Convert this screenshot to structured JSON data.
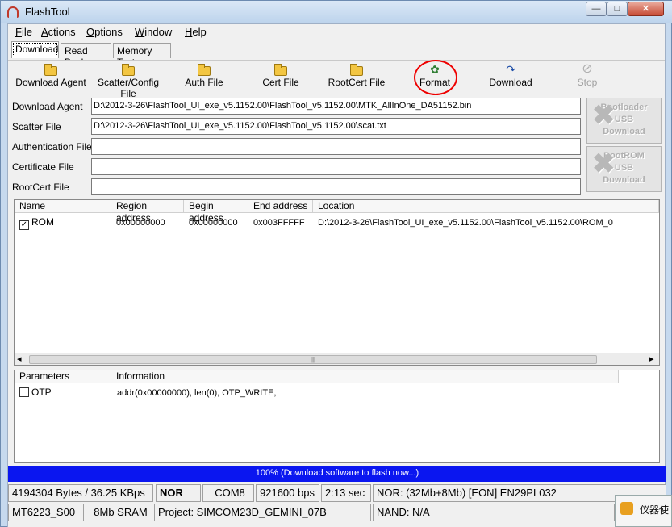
{
  "window": {
    "title": "FlashTool",
    "minimize": "—",
    "maximize": "□",
    "close": "✕"
  },
  "menu": {
    "file_u": "F",
    "file_rest": "ile",
    "actions_u": "A",
    "actions_rest": "ctions",
    "options_u": "O",
    "options_rest": "ptions",
    "window_u": "W",
    "window_rest": "indow",
    "help_u": "H",
    "help_rest": "elp"
  },
  "tabs": {
    "download": "Download",
    "readback": "Read Back",
    "memtest": "Memory Test"
  },
  "toolbar": {
    "download_agent": "Download Agent",
    "scatter_config": "Scatter/Config File",
    "auth_file": "Auth File",
    "cert_file": "Cert File",
    "rootcert_file": "RootCert File",
    "format": "Format",
    "download": "Download",
    "stop": "Stop"
  },
  "files": {
    "da_label": "Download Agent",
    "da_value": "D:\\2012-3-26\\FlashTool_UI_exe_v5.1152.00\\FlashTool_v5.1152.00\\MTK_AllInOne_DA51152.bin",
    "scatter_label": "Scatter File",
    "scatter_value": "D:\\2012-3-26\\FlashTool_UI_exe_v5.1152.00\\FlashTool_v5.1152.00\\scat.txt",
    "auth_label": "Authentication File",
    "auth_value": "",
    "cert_label": "Certificate File",
    "cert_value": "",
    "rootcert_label": "RootCert File",
    "rootcert_value": ""
  },
  "side_buttons": {
    "bootloader": [
      "Bootloader",
      "USB",
      "Download"
    ],
    "bootrom": [
      "BootROM",
      "USB",
      "Download"
    ]
  },
  "region_table": {
    "headers": [
      "Name",
      "Region address",
      "Begin address",
      "End address",
      "Location"
    ],
    "rows": [
      {
        "checked": "✓",
        "name": "ROM",
        "region": "0x00000000",
        "begin": "0x00000000",
        "end": "0x003FFFFF",
        "location": "D:\\2012-3-26\\FlashTool_UI_exe_v5.1152.00\\FlashTool_v5.1152.00\\ROM_0"
      }
    ],
    "scroll_left": "◂",
    "scroll_right": "▸",
    "scroll_grip": "|||"
  },
  "params_table": {
    "headers": [
      "Parameters",
      "Information"
    ],
    "rows": [
      {
        "checked": "",
        "name": "OTP",
        "info": "addr(0x00000000), len(0), OTP_WRITE,"
      }
    ]
  },
  "progress": {
    "text": "100% (Download software to flash now...)",
    "fraction": 1.0
  },
  "status": {
    "bytes": "4194304 Bytes / 36.25 KBps",
    "type": "NOR",
    "port": "COM8",
    "baud": "921600 bps",
    "time": "2:13 sec",
    "nor": "NOR: (32Mb+8Mb) [EON] EN29PL032",
    "chip": "MT6223_S00",
    "sram": "8Mb SRAM",
    "project": "Project: SIMCOM23D_GEMINI_07B",
    "nand": "NAND: N/A"
  },
  "taskbar_popup": "仪器使",
  "colors": {
    "progress": "#0a16f0",
    "format_highlight": "#ee0000",
    "titlebar": "#c6d9ee"
  }
}
